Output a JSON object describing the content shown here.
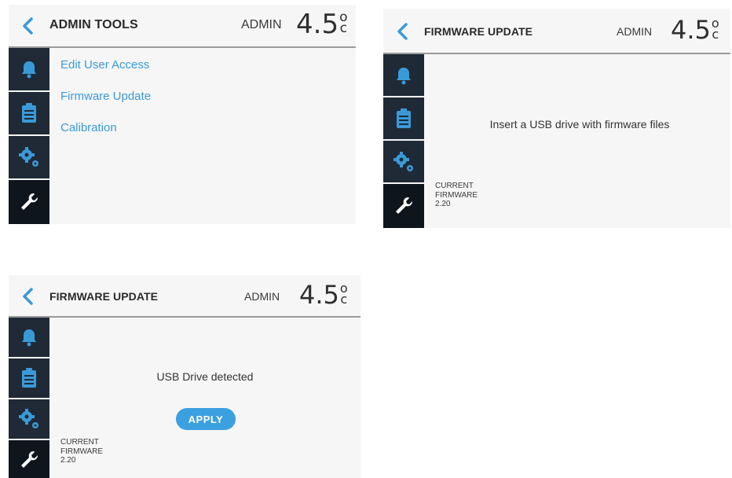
{
  "colors": {
    "accent": "#3a9ad8",
    "sidebar": "#1f2a36",
    "sidebar_icon": "#3a9ad8",
    "apply_button": "#3aa0e0",
    "panel_bg": "#f6f6f6"
  },
  "icons": {
    "back": "chevron-left-icon",
    "alarms": "bell-icon",
    "log": "clipboard-icon",
    "settings": "gears-icon",
    "tools": "wrench-icon"
  },
  "screens": [
    {
      "header": {
        "title": "ADMIN TOOLS",
        "user": "ADMIN",
        "temp_value": "4.5",
        "temp_deg": "o",
        "temp_unit": "c"
      },
      "menu": [
        "Edit User Access",
        "Firmware Update",
        "Calibration"
      ]
    },
    {
      "header": {
        "title": "FIRMWARE UPDATE",
        "user": "ADMIN",
        "temp_value": "4.5",
        "temp_deg": "o",
        "temp_unit": "c"
      },
      "message": "Insert a USB drive with firmware files",
      "firmware": {
        "label1": "CURRENT",
        "label2": "FIRMWARE",
        "version": "2.20"
      }
    },
    {
      "header": {
        "title": "FIRMWARE UPDATE",
        "user": "ADMIN",
        "temp_value": "4.5",
        "temp_deg": "o",
        "temp_unit": "c"
      },
      "message": "USB Drive detected",
      "apply_label": "APPLY",
      "firmware": {
        "label1": "CURRENT",
        "label2": "FIRMWARE",
        "version": "2.20"
      }
    }
  ]
}
